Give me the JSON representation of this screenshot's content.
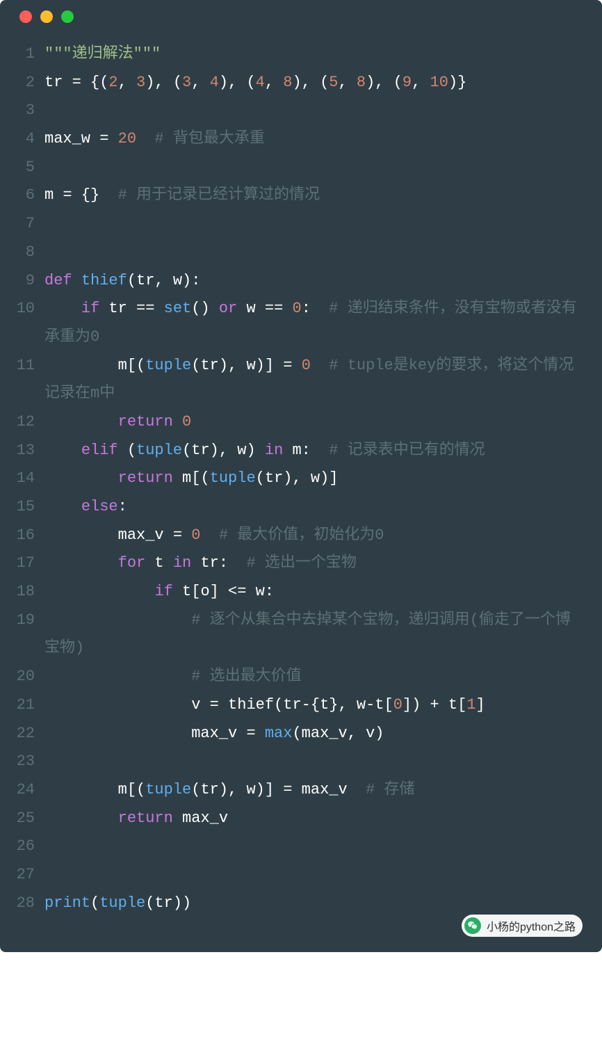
{
  "watermark": {
    "text": "小杨的python之路"
  },
  "code": {
    "lines": [
      {
        "n": "1",
        "tokens": [
          {
            "c": "tok-string",
            "t": "\"\"\"递归解法\"\"\""
          }
        ]
      },
      {
        "n": "2",
        "tokens": [
          {
            "c": "tok-white",
            "t": "tr = {("
          },
          {
            "c": "tok-number",
            "t": "2"
          },
          {
            "c": "tok-white",
            "t": ", "
          },
          {
            "c": "tok-number",
            "t": "3"
          },
          {
            "c": "tok-white",
            "t": "), ("
          },
          {
            "c": "tok-number",
            "t": "3"
          },
          {
            "c": "tok-white",
            "t": ", "
          },
          {
            "c": "tok-number",
            "t": "4"
          },
          {
            "c": "tok-white",
            "t": "), ("
          },
          {
            "c": "tok-number",
            "t": "4"
          },
          {
            "c": "tok-white",
            "t": ", "
          },
          {
            "c": "tok-number",
            "t": "8"
          },
          {
            "c": "tok-white",
            "t": "), ("
          },
          {
            "c": "tok-number",
            "t": "5"
          },
          {
            "c": "tok-white",
            "t": ", "
          },
          {
            "c": "tok-number",
            "t": "8"
          },
          {
            "c": "tok-white",
            "t": "), ("
          },
          {
            "c": "tok-number",
            "t": "9"
          },
          {
            "c": "tok-white",
            "t": ", "
          },
          {
            "c": "tok-number",
            "t": "10"
          },
          {
            "c": "tok-white",
            "t": ")}"
          }
        ]
      },
      {
        "n": "3",
        "tokens": [
          {
            "c": "tok-white",
            "t": ""
          }
        ]
      },
      {
        "n": "4",
        "tokens": [
          {
            "c": "tok-white",
            "t": "max_w = "
          },
          {
            "c": "tok-number",
            "t": "20"
          },
          {
            "c": "tok-white",
            "t": "  "
          },
          {
            "c": "tok-comment",
            "t": "# 背包最大承重"
          }
        ]
      },
      {
        "n": "5",
        "tokens": [
          {
            "c": "tok-white",
            "t": ""
          }
        ]
      },
      {
        "n": "6",
        "tokens": [
          {
            "c": "tok-white",
            "t": "m = {}  "
          },
          {
            "c": "tok-comment",
            "t": "# 用于记录已经计算过的情况"
          }
        ]
      },
      {
        "n": "7",
        "tokens": [
          {
            "c": "tok-white",
            "t": ""
          }
        ]
      },
      {
        "n": "8",
        "tokens": [
          {
            "c": "tok-white",
            "t": ""
          }
        ]
      },
      {
        "n": "9",
        "tokens": [
          {
            "c": "tok-keyword",
            "t": "def"
          },
          {
            "c": "tok-white",
            "t": " "
          },
          {
            "c": "tok-func",
            "t": "thief"
          },
          {
            "c": "tok-white",
            "t": "(tr, w):"
          }
        ]
      },
      {
        "n": "10",
        "tokens": [
          {
            "c": "tok-white",
            "t": "    "
          },
          {
            "c": "tok-keyword",
            "t": "if"
          },
          {
            "c": "tok-white",
            "t": " tr == "
          },
          {
            "c": "tok-func",
            "t": "set"
          },
          {
            "c": "tok-white",
            "t": "() "
          },
          {
            "c": "tok-keyword",
            "t": "or"
          },
          {
            "c": "tok-white",
            "t": " w == "
          },
          {
            "c": "tok-number",
            "t": "0"
          },
          {
            "c": "tok-white",
            "t": ":  "
          },
          {
            "c": "tok-comment",
            "t": "# 递归结束条件，没有宝物或者没有承重为0"
          }
        ]
      },
      {
        "n": "11",
        "tokens": [
          {
            "c": "tok-white",
            "t": "        m[("
          },
          {
            "c": "tok-func",
            "t": "tuple"
          },
          {
            "c": "tok-white",
            "t": "(tr), w)] = "
          },
          {
            "c": "tok-number",
            "t": "0"
          },
          {
            "c": "tok-white",
            "t": "  "
          },
          {
            "c": "tok-comment",
            "t": "# tuple是key的要求，将这个情况记录在m中"
          }
        ]
      },
      {
        "n": "12",
        "tokens": [
          {
            "c": "tok-white",
            "t": "        "
          },
          {
            "c": "tok-keyword",
            "t": "return"
          },
          {
            "c": "tok-white",
            "t": " "
          },
          {
            "c": "tok-number",
            "t": "0"
          }
        ]
      },
      {
        "n": "13",
        "tokens": [
          {
            "c": "tok-white",
            "t": "    "
          },
          {
            "c": "tok-keyword",
            "t": "elif"
          },
          {
            "c": "tok-white",
            "t": " ("
          },
          {
            "c": "tok-func",
            "t": "tuple"
          },
          {
            "c": "tok-white",
            "t": "(tr), w) "
          },
          {
            "c": "tok-keyword",
            "t": "in"
          },
          {
            "c": "tok-white",
            "t": " m:  "
          },
          {
            "c": "tok-comment",
            "t": "# 记录表中已有的情况"
          }
        ]
      },
      {
        "n": "14",
        "tokens": [
          {
            "c": "tok-white",
            "t": "        "
          },
          {
            "c": "tok-keyword",
            "t": "return"
          },
          {
            "c": "tok-white",
            "t": " m[("
          },
          {
            "c": "tok-func",
            "t": "tuple"
          },
          {
            "c": "tok-white",
            "t": "(tr), w)]"
          }
        ]
      },
      {
        "n": "15",
        "tokens": [
          {
            "c": "tok-white",
            "t": "    "
          },
          {
            "c": "tok-keyword",
            "t": "else"
          },
          {
            "c": "tok-white",
            "t": ":"
          }
        ]
      },
      {
        "n": "16",
        "tokens": [
          {
            "c": "tok-white",
            "t": "        max_v = "
          },
          {
            "c": "tok-number",
            "t": "0"
          },
          {
            "c": "tok-white",
            "t": "  "
          },
          {
            "c": "tok-comment",
            "t": "# 最大价值，初始化为0"
          }
        ]
      },
      {
        "n": "17",
        "tokens": [
          {
            "c": "tok-white",
            "t": "        "
          },
          {
            "c": "tok-keyword",
            "t": "for"
          },
          {
            "c": "tok-white",
            "t": " t "
          },
          {
            "c": "tok-keyword",
            "t": "in"
          },
          {
            "c": "tok-white",
            "t": " tr:  "
          },
          {
            "c": "tok-comment",
            "t": "# 选出一个宝物"
          }
        ]
      },
      {
        "n": "18",
        "tokens": [
          {
            "c": "tok-white",
            "t": "            "
          },
          {
            "c": "tok-keyword",
            "t": "if"
          },
          {
            "c": "tok-white",
            "t": " t[o] <= w:"
          }
        ]
      },
      {
        "n": "19",
        "tokens": [
          {
            "c": "tok-white",
            "t": "                "
          },
          {
            "c": "tok-comment",
            "t": "# 逐个从集合中去掉某个宝物，递归调用(偷走了一个博宝物)"
          }
        ]
      },
      {
        "n": "20",
        "tokens": [
          {
            "c": "tok-white",
            "t": "                "
          },
          {
            "c": "tok-comment",
            "t": "# 选出最大价值"
          }
        ]
      },
      {
        "n": "21",
        "tokens": [
          {
            "c": "tok-white",
            "t": "                v = thief(tr-{t}, w-t["
          },
          {
            "c": "tok-number",
            "t": "0"
          },
          {
            "c": "tok-white",
            "t": "]) + t["
          },
          {
            "c": "tok-number",
            "t": "1"
          },
          {
            "c": "tok-white",
            "t": "]"
          }
        ]
      },
      {
        "n": "22",
        "tokens": [
          {
            "c": "tok-white",
            "t": "                max_v = "
          },
          {
            "c": "tok-func",
            "t": "max"
          },
          {
            "c": "tok-white",
            "t": "(max_v, v)"
          }
        ]
      },
      {
        "n": "23",
        "tokens": [
          {
            "c": "tok-white",
            "t": ""
          }
        ]
      },
      {
        "n": "24",
        "tokens": [
          {
            "c": "tok-white",
            "t": "        m[("
          },
          {
            "c": "tok-func",
            "t": "tuple"
          },
          {
            "c": "tok-white",
            "t": "(tr), w)] = max_v  "
          },
          {
            "c": "tok-comment",
            "t": "# 存储"
          }
        ]
      },
      {
        "n": "25",
        "tokens": [
          {
            "c": "tok-white",
            "t": "        "
          },
          {
            "c": "tok-keyword",
            "t": "return"
          },
          {
            "c": "tok-white",
            "t": " max_v"
          }
        ]
      },
      {
        "n": "26",
        "tokens": [
          {
            "c": "tok-white",
            "t": ""
          }
        ]
      },
      {
        "n": "27",
        "tokens": [
          {
            "c": "tok-white",
            "t": ""
          }
        ]
      },
      {
        "n": "28",
        "tokens": [
          {
            "c": "tok-func",
            "t": "print"
          },
          {
            "c": "tok-white",
            "t": "("
          },
          {
            "c": "tok-func",
            "t": "tuple"
          },
          {
            "c": "tok-white",
            "t": "(tr))"
          }
        ]
      }
    ]
  }
}
